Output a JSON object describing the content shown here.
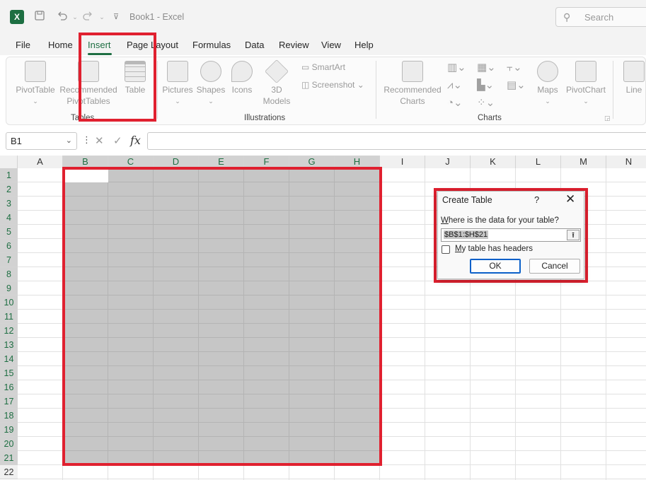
{
  "titlebar": {
    "title": "Book1  -  Excel",
    "logo": "X",
    "search_placeholder": "Search",
    "icons": [
      "save-icon",
      "undo-icon",
      "redo-icon",
      "customize-icon"
    ]
  },
  "menu": {
    "tabs": [
      "File",
      "Home",
      "Insert",
      "Page Layout",
      "Formulas",
      "Data",
      "Review",
      "View",
      "Help"
    ],
    "active": "Insert"
  },
  "ribbon": {
    "pivottable": "PivotTable",
    "recommended_pivot_1": "Recommended",
    "recommended_pivot_2": "PivotTables",
    "table": "Table",
    "pictures": "Pictures",
    "shapes": "Shapes",
    "icons": "Icons",
    "models_1": "3D",
    "models_2": "Models",
    "smartart": "SmartArt",
    "screenshot": "Screenshot",
    "rec_charts_1": "Recommended",
    "rec_charts_2": "Charts",
    "maps": "Maps",
    "pivotchart": "PivotChart",
    "line": "Line",
    "groups": {
      "tables": "Tables",
      "illustrations": "Illustrations",
      "charts": "Charts"
    }
  },
  "formula_bar": {
    "name_box": "B1",
    "cancel_glyph": "✕",
    "enter_glyph": "✓",
    "fx_glyph": "fx",
    "formula": ""
  },
  "grid": {
    "columns": [
      "A",
      "B",
      "C",
      "D",
      "E",
      "F",
      "G",
      "H",
      "I",
      "J",
      "K",
      "L",
      "M",
      "N"
    ],
    "rows": [
      "1",
      "2",
      "3",
      "4",
      "5",
      "6",
      "7",
      "8",
      "9",
      "10",
      "11",
      "12",
      "13",
      "14",
      "15",
      "16",
      "17",
      "18",
      "19",
      "20",
      "21",
      "22"
    ],
    "selected_columns": [
      "B",
      "C",
      "D",
      "E",
      "F",
      "G",
      "H"
    ],
    "selected_rows_through": 21
  },
  "dialog": {
    "title": "Create Table",
    "help": "?",
    "close": "✕",
    "prompt": "Where is the data for your table?",
    "range": "$B$1:$H$21",
    "checkbox_label": "My table has headers",
    "checkbox_checked": false,
    "ok": "OK",
    "cancel": "Cancel"
  },
  "colors": {
    "excel_green": "#1e6e42",
    "highlight_red": "#e0202f",
    "selection_gray": "#c6c6c6"
  }
}
